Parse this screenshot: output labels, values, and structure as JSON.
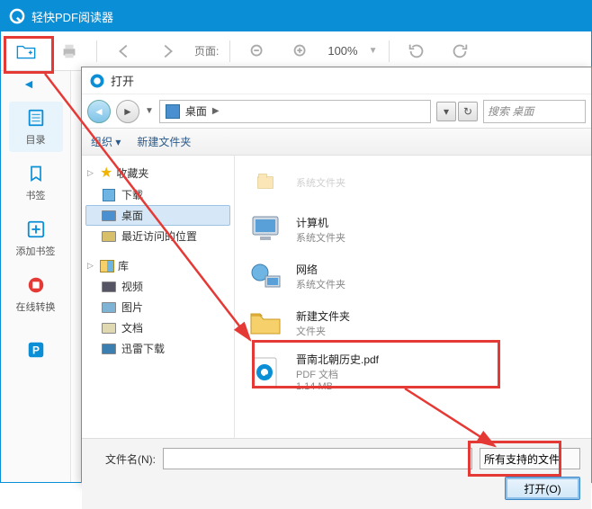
{
  "app": {
    "title": "轻快PDF阅读器",
    "toolbar": {
      "page_label": "页面:",
      "zoom": "100%"
    }
  },
  "sidebar": {
    "items": [
      {
        "label": "目录"
      },
      {
        "label": "书签"
      },
      {
        "label": "添加书签"
      },
      {
        "label": "在线转换"
      }
    ]
  },
  "dialog": {
    "title": "打开",
    "breadcrumb": {
      "location": "桌面"
    },
    "search_placeholder": "搜索 桌面",
    "toolbar": {
      "organize": "组织 ▾",
      "new_folder": "新建文件夹"
    },
    "tree": {
      "favorites": {
        "label": "收藏夹",
        "items": [
          {
            "label": "下载"
          },
          {
            "label": "桌面"
          },
          {
            "label": "最近访问的位置"
          }
        ]
      },
      "libraries": {
        "label": "库",
        "items": [
          {
            "label": "视频"
          },
          {
            "label": "图片"
          },
          {
            "label": "文档"
          },
          {
            "label": "迅雷下载"
          }
        ]
      }
    },
    "list": [
      {
        "name": "计算机",
        "sub": "系统文件夹",
        "icon": "computer"
      },
      {
        "name": "网络",
        "sub": "系统文件夹",
        "icon": "network"
      },
      {
        "name": "新建文件夹",
        "sub": "文件夹",
        "icon": "folder"
      },
      {
        "name": "晋南北朝历史.pdf",
        "sub": "PDF 文档",
        "size": "1.14 MB",
        "icon": "pdf"
      }
    ],
    "filename_label": "文件名(N):",
    "filetype": "所有支持的文件",
    "open_btn": "打开(O)"
  }
}
